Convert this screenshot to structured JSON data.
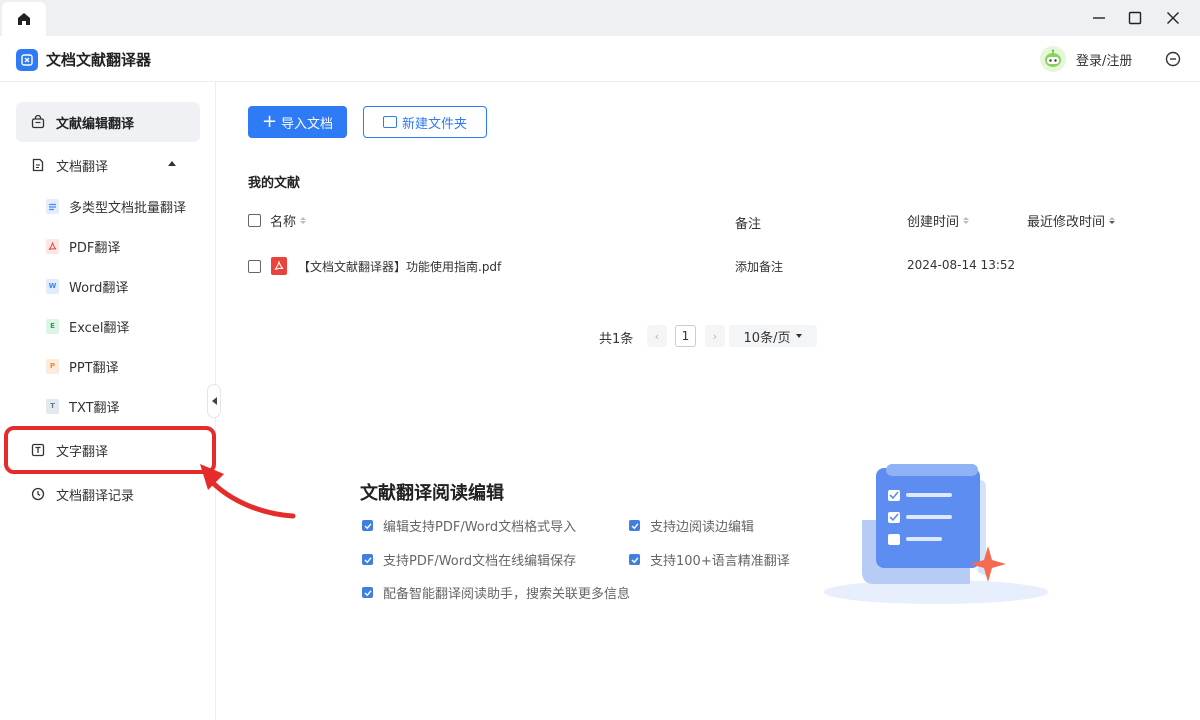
{
  "app": {
    "title": "文档文献翻译器",
    "login_label": "登录/注册"
  },
  "sidebar": {
    "items": [
      {
        "label": "文献编辑翻译",
        "icon": "bag-icon",
        "active": true
      },
      {
        "label": "文档翻译",
        "icon": "document-icon",
        "expanded": true
      },
      {
        "label": "文字翻译",
        "icon": "text-icon"
      },
      {
        "label": "文档翻译记录",
        "icon": "clock-icon"
      }
    ],
    "sub_items": [
      {
        "label": "多类型文档批量翻译",
        "icon": "multi-doc-icon",
        "color": "#4a8ef5"
      },
      {
        "label": "PDF翻译",
        "icon": "pdf-icon",
        "color": "#e9433b"
      },
      {
        "label": "Word翻译",
        "icon": "word-icon",
        "color": "#3b82f6"
      },
      {
        "label": "Excel翻译",
        "icon": "excel-icon",
        "color": "#22a35a"
      },
      {
        "label": "PPT翻译",
        "icon": "ppt-icon",
        "color": "#f08a3c"
      },
      {
        "label": "TXT翻译",
        "icon": "txt-icon",
        "color": "#6b7c99"
      }
    ]
  },
  "toolbar": {
    "import_label": "导入文档",
    "new_folder_label": "新建文件夹"
  },
  "library": {
    "title": "我的文献",
    "columns": [
      "名称",
      "备注",
      "创建时间",
      "最近修改时间"
    ],
    "rows": [
      {
        "name": "【文档文献翻译器】功能使用指南.pdf",
        "note": "添加备注",
        "created": "2024-08-14 13:52",
        "modified": ""
      }
    ]
  },
  "pager": {
    "total": "共1条",
    "current_page": "1",
    "page_size": "10条/页"
  },
  "promo": {
    "title": "文献翻译阅读编辑",
    "features": [
      "编辑支持PDF/Word文档格式导入",
      "支持边阅读边编辑",
      "支持PDF/Word文档在线编辑保存",
      "支持100+语言精准翻译",
      "配备智能翻译阅读助手，搜索关联更多信息"
    ]
  },
  "colors": {
    "accent": "#2f7bf5",
    "highlight": "#e52b2b"
  }
}
